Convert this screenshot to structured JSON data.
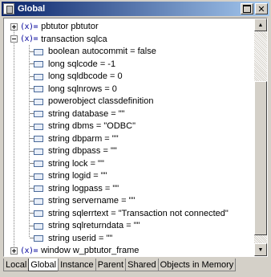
{
  "window": {
    "title": "Global",
    "max_label": "",
    "close_label": "✕"
  },
  "tree": {
    "items": [
      {
        "level": 0,
        "expander": "plus",
        "icon": "(x)=",
        "label": "pbtutor pbtutor"
      },
      {
        "level": 0,
        "expander": "minus",
        "icon": "(x)=",
        "label": "transaction sqlca"
      },
      {
        "level": 1,
        "label": "boolean autocommit = false"
      },
      {
        "level": 1,
        "label": "long sqlcode = -1"
      },
      {
        "level": 1,
        "label": "long sqldbcode = 0"
      },
      {
        "level": 1,
        "label": "long sqlnrows = 0"
      },
      {
        "level": 1,
        "label": "powerobject classdefinition"
      },
      {
        "level": 1,
        "label": "string database = \"\""
      },
      {
        "level": 1,
        "label": "string dbms = \"ODBC\""
      },
      {
        "level": 1,
        "label": "string dbparm = \"\""
      },
      {
        "level": 1,
        "label": "string dbpass = \"\""
      },
      {
        "level": 1,
        "label": "string lock = \"\""
      },
      {
        "level": 1,
        "label": "string logid = \"\""
      },
      {
        "level": 1,
        "label": "string logpass = \"\""
      },
      {
        "level": 1,
        "label": "string servername = \"\""
      },
      {
        "level": 1,
        "label": "string sqlerrtext = \"Transaction not connected\""
      },
      {
        "level": 1,
        "label": "string sqlreturndata = \"\""
      },
      {
        "level": 1,
        "label": "string userid = \"\""
      },
      {
        "level": 0,
        "expander": "plus",
        "icon": "(x)=",
        "label": "window w_pbtutor_frame"
      }
    ]
  },
  "scrollbar": {
    "up_glyph": "▲",
    "down_glyph": "▼",
    "position_fraction": 0.3
  },
  "tabs": [
    {
      "label": "Local",
      "active": false
    },
    {
      "label": "Global",
      "active": true
    },
    {
      "label": "Instance",
      "active": false
    },
    {
      "label": "Parent",
      "active": false
    },
    {
      "label": "Shared",
      "active": false
    },
    {
      "label": "Objects in Memory",
      "active": false
    }
  ]
}
